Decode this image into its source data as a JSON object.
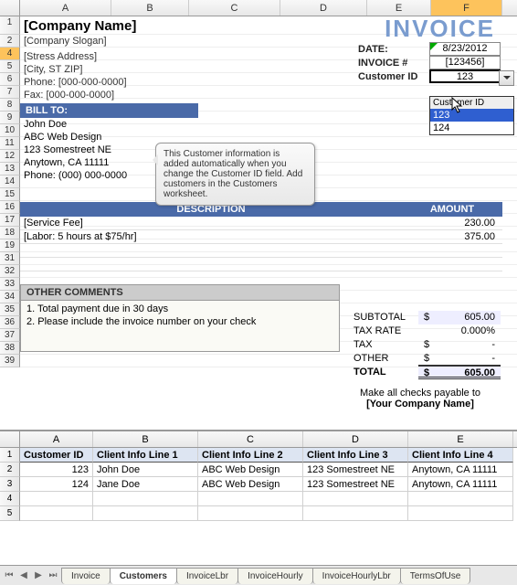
{
  "columns": [
    "A",
    "B",
    "C",
    "D",
    "E",
    "F"
  ],
  "company": {
    "name": "[Company Name]",
    "slogan": "[Company Slogan]"
  },
  "address": {
    "street": "[Stress Address]",
    "city": "[City, ST  ZIP]",
    "phone": "Phone: [000-000-0000]",
    "fax": "Fax: [000-000-0000]"
  },
  "invoice_title": "INVOICE",
  "meta": {
    "date_label": "DATE:",
    "date": "8/23/2012",
    "num_label": "INVOICE #",
    "num": "[123456]",
    "cust_label": "Customer ID",
    "cust": "123"
  },
  "dropdown": {
    "header": "Customer ID",
    "items": [
      "123",
      "124"
    ]
  },
  "billto": {
    "header": "BILL TO:",
    "lines": [
      "John Doe",
      "ABC Web Design",
      "123 Somestreet NE",
      "Anytown, CA 11111",
      "Phone: (000) 000-0000"
    ]
  },
  "callout": "This Customer information is added automatically when you change the Customer ID field. Add customers in the Customers worksheet.",
  "table": {
    "headers": {
      "desc": "DESCRIPTION",
      "amt": "AMOUNT"
    },
    "lines": [
      {
        "desc": "[Service Fee]",
        "amt": "230.00"
      },
      {
        "desc": "[Labor: 5 hours at $75/hr]",
        "amt": "375.00"
      }
    ]
  },
  "totals": {
    "subtotal_l": "SUBTOTAL",
    "subtotal": "605.00",
    "taxrate_l": "TAX RATE",
    "taxrate": "0.000%",
    "tax_l": "TAX",
    "tax": "-",
    "other_l": "OTHER",
    "other": "-",
    "total_l": "TOTAL",
    "total": "605.00",
    "cur": "$"
  },
  "comments": {
    "header": "OTHER COMMENTS",
    "lines": [
      "1. Total payment due in 30 days",
      "2. Please include the invoice number on your check"
    ]
  },
  "payable": {
    "text": "Make all checks payable to",
    "name": "[Your Company Name]"
  },
  "sheet2": {
    "cols": [
      "A",
      "B",
      "C",
      "D",
      "E"
    ],
    "headers": [
      "Customer ID",
      "Client Info Line 1",
      "Client Info Line 2",
      "Client Info Line 3",
      "Client Info Line 4"
    ],
    "rows": [
      [
        "123",
        "John Doe",
        "ABC Web Design",
        "123 Somestreet NE",
        "Anytown, CA 11111"
      ],
      [
        "124",
        "Jane Doe",
        "ABC Web Design",
        "123 Somestreet NE",
        "Anytown, CA 11111"
      ]
    ]
  },
  "tabs": [
    "Invoice",
    "Customers",
    "InvoiceLbr",
    "InvoiceHourly",
    "InvoiceHourlyLbr",
    "TermsOfUse"
  ]
}
